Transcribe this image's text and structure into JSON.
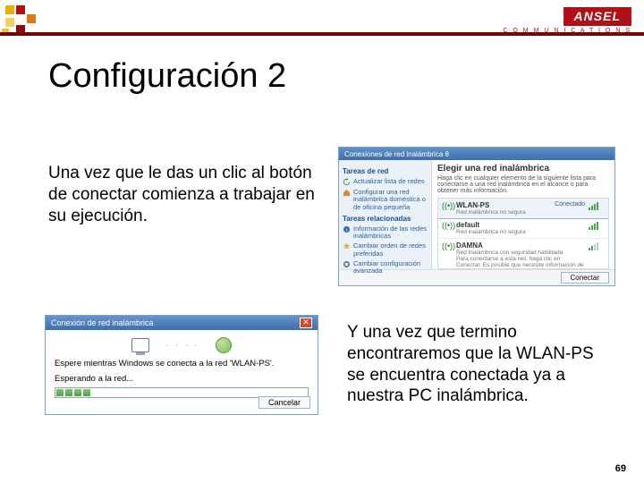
{
  "brand": {
    "name": "ANSEL",
    "sub": "C O M M U N I C A T I O N S"
  },
  "title": "Configuración 2",
  "para1": "Una vez que le das un clic al botón de conectar comienza a trabajar en su ejecución.",
  "para2": "Y una vez que termino encontraremos que la WLAN-PS se encuentra conectada ya a nuestra PC inalámbrica.",
  "page_number": "69",
  "dialog_choose": {
    "titlebar": "Conexiones de red inalámbrica 8",
    "left": {
      "section1": "Tareas de red",
      "item1": "Actualizar lista de redes",
      "item2": "Configurar una red inalámbrica doméstica o de oficina pequeña",
      "section2": "Tareas relacionadas",
      "item3": "Información de las redes inalámbricas",
      "item4": "Cambiar orden de redes preferidas",
      "item5": "Cambiar configuración avanzada"
    },
    "right": {
      "heading": "Elegir una red inalámbrica",
      "desc": "Haga clic en cualquier elemento de la siguiente lista para conectarse a una red inalámbrica en el alcance o para obtener más información.",
      "net1": {
        "name": "WLAN-PS",
        "status": "Conectado",
        "sub": "Red inalámbrica no segura"
      },
      "net2": {
        "name": "default",
        "sub": "Red inalámbrica no segura"
      },
      "net3": {
        "name": "DAMNA",
        "sub": "Red inalámbrica con seguridad habilitada",
        "desc2": "Para conectarse a esta red, haga clic en Conectar. Es posible que necesite información de inicio de sesión."
      }
    },
    "connect_btn": "Conectar"
  },
  "dialog_connecting": {
    "titlebar": "Conexión de red inalámbrica",
    "msg": "Espere mientras Windows se conecta a la red 'WLAN-PS'.",
    "waiting": "Esperando a la red...",
    "cancel_btn": "Cancelar"
  },
  "logo_colors": [
    "#e0b400",
    "#b01016",
    "#d87a1a",
    "#f0d060",
    "#8a1010",
    "#e8c030"
  ]
}
